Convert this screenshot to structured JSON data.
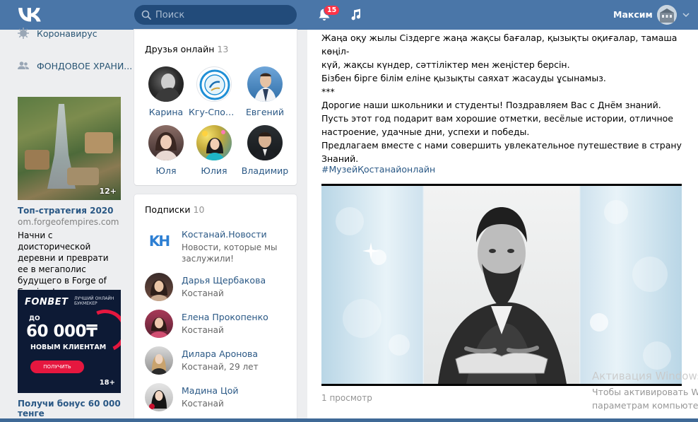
{
  "header": {
    "search_placeholder": "Поиск",
    "notifications_count": "15",
    "user_name": "Максим"
  },
  "left_nav": {
    "items": [
      {
        "label": "Коронавирус",
        "icon": "virus-icon"
      },
      {
        "label": "ФОНДОВОЕ ХРАНИ...",
        "icon": "group-icon"
      }
    ]
  },
  "ads": [
    {
      "image_badge": "12+",
      "title": "Топ-стратегия 2020",
      "domain": "om.forgeofempires.com",
      "text": "Начни с доисторической деревни и преврати ее в мегаполис будущего в Forge of Empires!"
    },
    {
      "logo": "FONBET",
      "logo_sub": "ЛУЧШИЙ ОНЛАЙН БУКМЕКЕР",
      "prefix": "ДО",
      "amount": "60 000₸",
      "subtitle": "НОВЫМ КЛИЕНТАМ",
      "button": "ПОЛУЧИТЬ",
      "age": "18+",
      "title": "Получи бонус 60 000 тенге"
    }
  ],
  "friends_online": {
    "title": "Друзья онлайн",
    "count": "13",
    "people": [
      {
        "name": "Карина"
      },
      {
        "name": "Кгу-Спортив..."
      },
      {
        "name": "Евгений"
      },
      {
        "name": "Юля"
      },
      {
        "name": "Юлия"
      },
      {
        "name": "Владимир"
      }
    ]
  },
  "subscriptions": {
    "title": "Подписки",
    "count": "10",
    "items": [
      {
        "name": "Костанай.Новости",
        "desc": "Новости, которые мы заслужили!",
        "logo_text": "KH"
      },
      {
        "name": "Дарья Щербакова",
        "desc": "Костанай"
      },
      {
        "name": "Елена Прокопенко",
        "desc": "Костанай"
      },
      {
        "name": "Дилара Аронова",
        "desc": "Костанай, 29 лет"
      },
      {
        "name": "Мадина Цой",
        "desc": "Костанай"
      }
    ]
  },
  "post": {
    "lines": [
      "Жаңа оқу жылы Сіздерге жаңа жақсы бағалар, қызықты оқиғалар, тамаша көңіл-",
      "күй, жақсы күндер, сәттіліктер мен жеңістер берсін.",
      "Бізбен бірге білім еліне қызықты саяхат жасауды ұсынамыз.",
      "***",
      "Дорогие наши школьники и студенты! Поздравляем Вас с Днём знаний.",
      "Пусть этот год подарит вам хорошие отметки, весёлые истории, отличное",
      "настроение, удачные дни, успехи и победы.",
      "Предлагаем вместе с нами совершить увлекательное путешествие в страну",
      "Знаний."
    ],
    "hashtag": "#МузейҚостанайонлайн",
    "views": "1 просмотр"
  },
  "watermark": {
    "line1": "Активация Windows",
    "line2": "Чтобы активировать Windows",
    "line3": "параметрам компьютера"
  },
  "colors": {
    "header": "#4a76a8",
    "link": "#2a5885",
    "badge": "#ff3347",
    "background": "#edeef0"
  }
}
